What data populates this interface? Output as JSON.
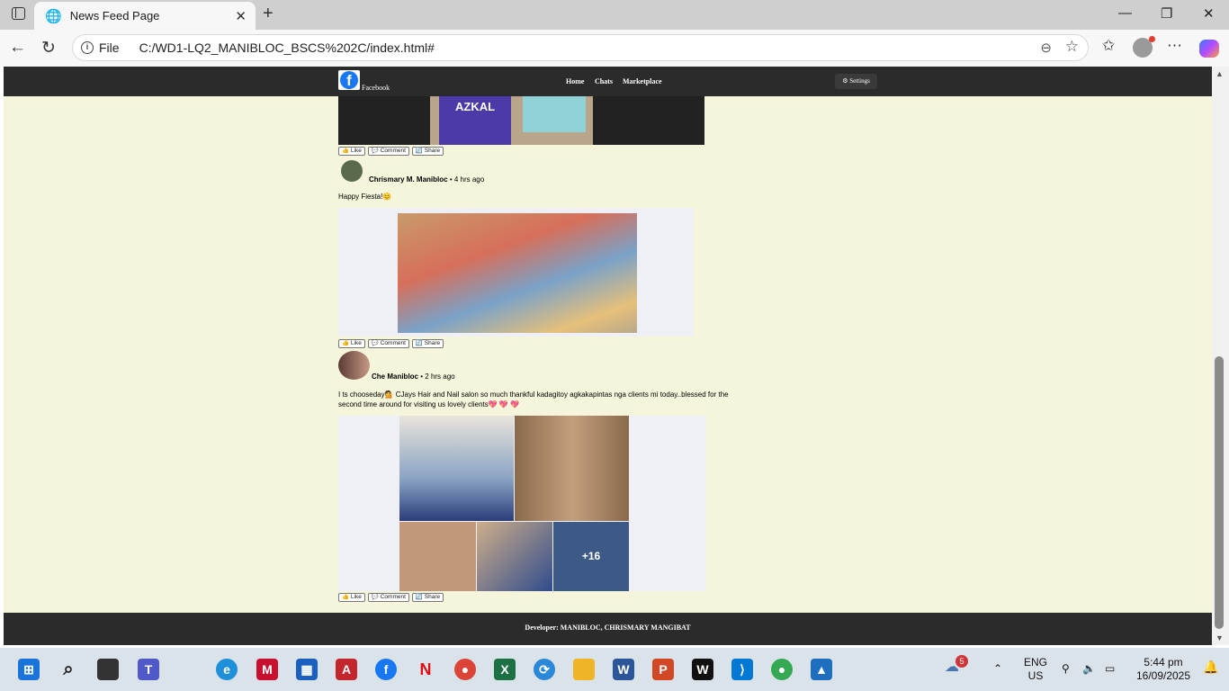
{
  "browser": {
    "tab_title": "News Feed Page",
    "file_label": "File",
    "url": "C:/WD1-LQ2_MANIBLOC_BSCS%202C/index.html#"
  },
  "nav": {
    "brand": "Facebook",
    "links": [
      "Home",
      "Chats",
      "Marketplace"
    ],
    "settings": "⚙ Settings"
  },
  "actions": {
    "like": "👍 Like",
    "comment": "💬 Comment",
    "share": "🔄 Share"
  },
  "posts": [
    {
      "author": "Chrismary M. Manibloc",
      "time": "• 4 hrs ago",
      "text": "Happy Fiesta!😊"
    },
    {
      "author": "Che Manibloc",
      "time": "• 2 hrs ago",
      "text": "I ts chooseday💁 CJays Hair and Nail salon so much thankful kadagitoy agkakapintas nga clients mi today..blessed for the second time around for visiting us lovely clients💖 💖 💖",
      "more": "+16"
    }
  ],
  "top_photo_text": "AZKAL",
  "footer": "Developer: MANIBLOC, CHRISMARY MANGIBAT",
  "taskbar": {
    "lang": "ENG",
    "region": "US",
    "time": "5:44 pm",
    "date": "16/09/2025",
    "weather_badge": "5"
  }
}
